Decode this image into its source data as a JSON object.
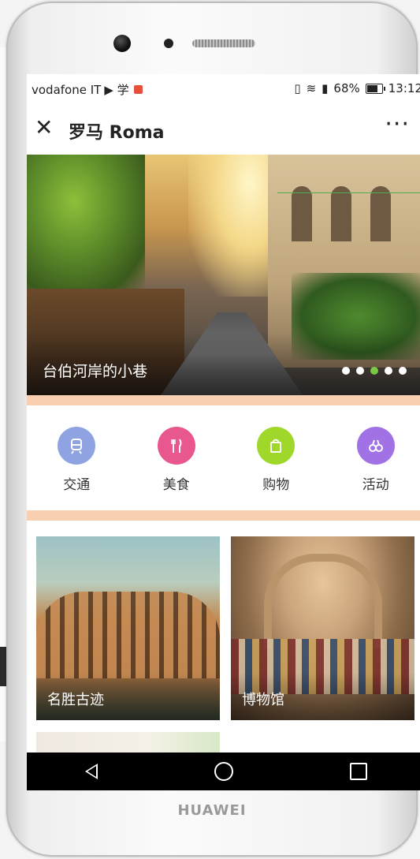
{
  "status_bar": {
    "carrier": "vodafone IT",
    "carrier_extra": "▶ 学",
    "battery_percent": "68%",
    "time": "13:12"
  },
  "header": {
    "title": "罗马 Roma",
    "close_glyph": "✕",
    "more_glyph": "···"
  },
  "banner": {
    "caption": "台伯河岸的小巷",
    "slide_count": 5,
    "active_slide": 3
  },
  "categories": [
    {
      "label": "交通",
      "icon": "tram-icon",
      "color": "#8fa3e3"
    },
    {
      "label": "美食",
      "icon": "fork-knife-icon",
      "color": "#e8588e"
    },
    {
      "label": "购物",
      "icon": "shopping-bag-icon",
      "color": "#9fd82a"
    },
    {
      "label": "活动",
      "icon": "binoculars-icon",
      "color": "#a171e6"
    }
  ],
  "tiles": [
    {
      "label": "名胜古迹",
      "image": "colosseum"
    },
    {
      "label": "博物馆",
      "image": "museum-fresco"
    }
  ],
  "device": {
    "brand": "HUAWEI"
  },
  "colors": {
    "peach_band": "#f8cfb0",
    "active_dot": "#7ac943"
  }
}
